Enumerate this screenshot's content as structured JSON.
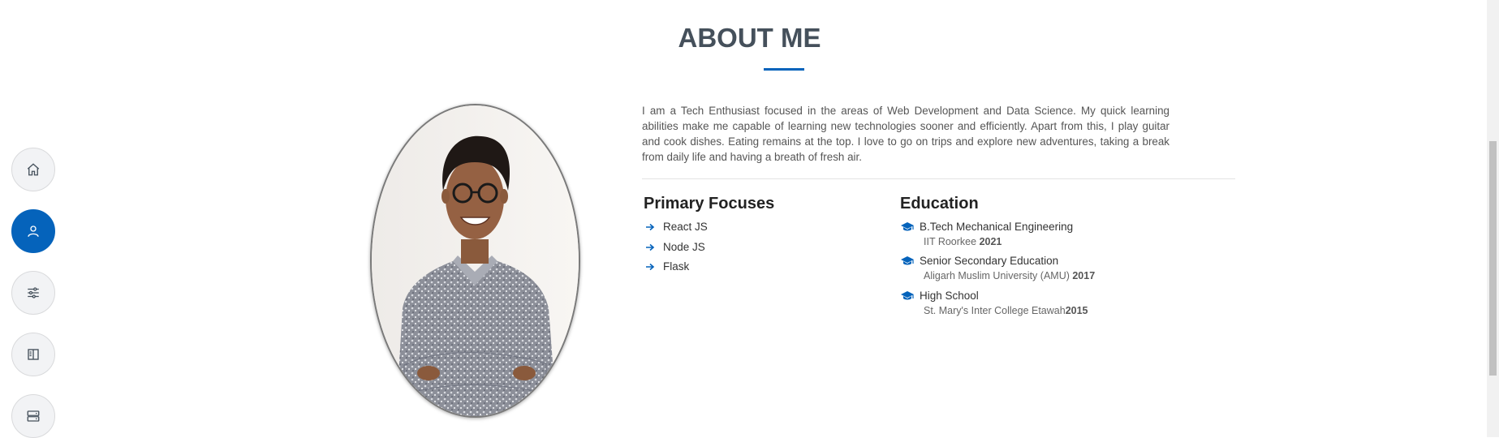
{
  "nav": {
    "items": [
      {
        "name": "home",
        "icon": "home-icon",
        "active": false
      },
      {
        "name": "about",
        "icon": "person-icon",
        "active": true
      },
      {
        "name": "skills",
        "icon": "sliders-icon",
        "active": false
      },
      {
        "name": "resume",
        "icon": "book-icon",
        "active": false
      },
      {
        "name": "services",
        "icon": "server-icon",
        "active": false
      }
    ]
  },
  "about": {
    "title": "ABOUT ME",
    "bio": "I am a Tech Enthusiast focused in the areas of Web Development and Data Science. My quick learning abilities make me capable of learning new technologies sooner and efficiently. Apart from this, I play guitar and cook dishes. Eating remains at the top. I love to go on trips and explore new adventures, taking a break from daily life and having a breath of fresh air."
  },
  "focuses": {
    "title": "Primary Focuses",
    "items": [
      "React JS",
      "Node JS",
      "Flask"
    ]
  },
  "education": {
    "title": "Education",
    "items": [
      {
        "degree": "B.Tech Mechanical Engineering",
        "school": "IIT Roorkee ",
        "year": "2021"
      },
      {
        "degree": "Senior Secondary Education",
        "school": "Aligarh Muslim University (AMU) ",
        "year": "2017"
      },
      {
        "degree": "High School",
        "school": "St. Mary's Inter College Etawah",
        "year": "2015"
      }
    ]
  },
  "colors": {
    "accent": "#0563bb",
    "title": "#45505b"
  }
}
